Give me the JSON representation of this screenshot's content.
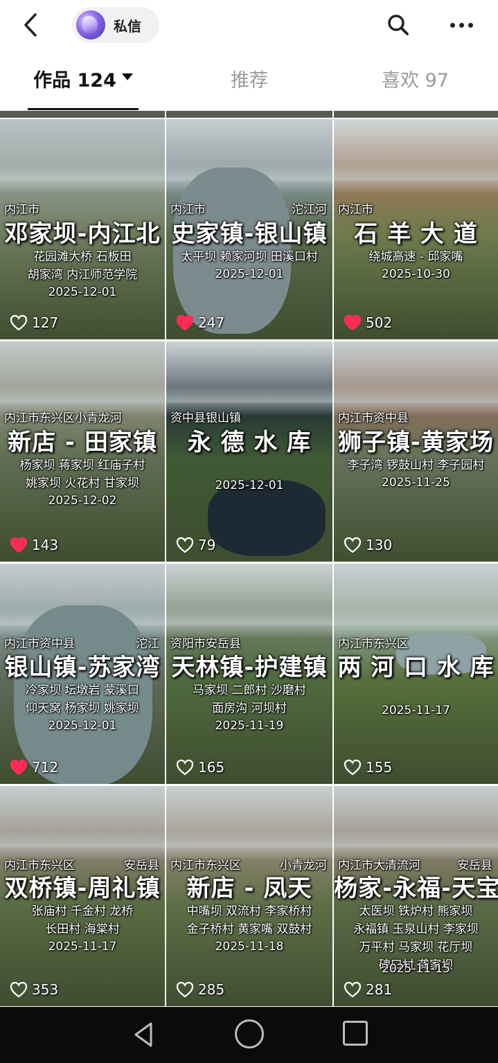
{
  "header": {
    "back_icon": "chevron-left-icon",
    "private_message_label": "私信",
    "search_icon": "search-icon",
    "more_icon": "more-horizontal-icon"
  },
  "tabs": [
    {
      "label": "作品 124",
      "active": true
    },
    {
      "label": "推荐",
      "active": false
    },
    {
      "label": "喜欢 97",
      "active": false
    }
  ],
  "videos": [
    {
      "loc_left": "内江市",
      "loc_right": "",
      "title": "邓家坝-内江北",
      "sub1": "花园滩大桥 石板田",
      "sub2": "胡家湾 内江师范学院",
      "date": "2025-12-01",
      "likes": "127",
      "liked": false
    },
    {
      "loc_left": "内江市",
      "loc_right": "沱江河",
      "title": "史家镇-银山镇",
      "sub1": "太平坝 赖家河坝 田溪口村",
      "sub2": "",
      "date": "2025-12-01",
      "likes": "247",
      "liked": true
    },
    {
      "loc_left": "内江市",
      "loc_right": "",
      "title": "石 羊 大 道",
      "sub1": "绕城高速 - 邱家嘴",
      "sub2": "",
      "date": "2025-10-30",
      "likes": "502",
      "liked": true
    },
    {
      "loc_left": "内江市东兴区小青龙河",
      "loc_right": "",
      "title": "新店 - 田家镇",
      "sub1": "杨家坝 蒋家坝 红庙子村",
      "sub2": "姚家坝 火花村 甘家坝",
      "date": "2025-12-02",
      "likes": "143",
      "liked": true
    },
    {
      "loc_left": "资中县银山镇",
      "loc_right": "",
      "title": "永 德 水 库",
      "sub1": "",
      "sub2": "",
      "date": "2025-12-01",
      "likes": "79",
      "liked": false
    },
    {
      "loc_left": "内江市资中县",
      "loc_right": "",
      "title": "狮子镇-黄家场",
      "sub1": "李子湾 锣鼓山村 李子园村",
      "sub2": "",
      "date": "2025-11-25",
      "likes": "130",
      "liked": false
    },
    {
      "loc_left": "内江市资中县",
      "loc_right": "沱江",
      "title": "银山镇-苏家湾",
      "sub1": "冷家坝 坛墩岩 蒙溪口",
      "sub2": "仰天窝 杨家坝 姚家坝",
      "date": "2025-12-01",
      "likes": "712",
      "liked": true
    },
    {
      "loc_left": "资阳市安岳县",
      "loc_right": "",
      "title": "天林镇-护建镇",
      "sub1": "马家坝 二郎村 沙磨村",
      "sub2": "面房沟 河坝村",
      "date": "2025-11-19",
      "likes": "165",
      "liked": false
    },
    {
      "loc_left": "内江市东兴区",
      "loc_right": "",
      "title": "两 河 口 水 库",
      "sub1": "",
      "sub2": "",
      "date": "2025-11-17",
      "likes": "155",
      "liked": false
    },
    {
      "loc_left": "内江市东兴区",
      "loc_right": "安岳县",
      "title": "双桥镇-周礼镇",
      "sub1": "张庙村 千金村 龙桥",
      "sub2": "长田村 海棠村",
      "date": "2025-11-17",
      "likes": "353",
      "liked": false
    },
    {
      "loc_left": "内江市东兴区",
      "loc_right": "小青龙河",
      "title": "新店 - 凤天",
      "sub1": "中嘴坝 双流村 李家桥村",
      "sub2": "金子桥村 黄家嘴 双鼓村",
      "date": "2025-11-18",
      "likes": "285",
      "liked": false
    },
    {
      "loc_left": "内江市大清流河",
      "loc_right": "安岳县",
      "title": "杨家-永福-天宝",
      "sub1": "太医坝 铁炉村 熊家坝",
      "sub2": "永福镇 玉泉山村 李家坝",
      "sub3": "万平村 马家坝 花厅坝",
      "sub4": "碑口村 龚家坝",
      "date": "2025-11-15",
      "likes": "281",
      "liked": false
    }
  ],
  "colors": {
    "like_red": "#ff2c55",
    "tab_inactive": "#9a9a9a",
    "text_dark": "#111111"
  },
  "navbar": {
    "back_icon": "triangle-back-icon",
    "home_icon": "circle-home-icon",
    "recent_icon": "square-recents-icon"
  }
}
